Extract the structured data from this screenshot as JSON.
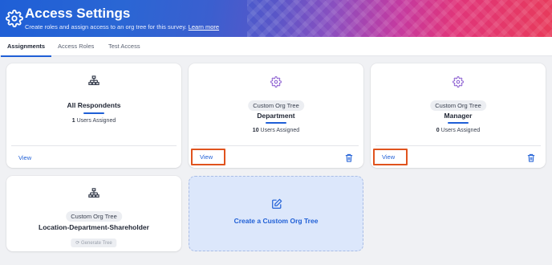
{
  "header": {
    "title": "Access Settings",
    "subtitle": "Create roles and assign access to an org tree for this survey.",
    "learn_more": "Learn more"
  },
  "tabs": [
    {
      "label": "Assignments",
      "active": true
    },
    {
      "label": "Access Roles",
      "active": false
    },
    {
      "label": "Test Access",
      "active": false
    }
  ],
  "cards": {
    "all_respondents": {
      "title": "All Respondents",
      "users_count": "1",
      "users_suffix": " Users Assigned",
      "view": "View"
    },
    "department": {
      "badge": "Custom Org Tree",
      "title": "Department",
      "users_count": "10",
      "users_suffix": " Users Assigned",
      "view": "View"
    },
    "manager": {
      "badge": "Custom Org Tree",
      "title": "Manager",
      "users_count": "0",
      "users_suffix": " Users Assigned",
      "view": "View"
    },
    "location": {
      "badge": "Custom Org Tree",
      "title": "Location-Department-Shareholder",
      "generate": "Generate Tree"
    },
    "create": {
      "title": "Create a Custom Org Tree"
    }
  },
  "colors": {
    "accent": "#1f5fd6",
    "highlight": "#e0531e",
    "icon_purple": "#8a5cd0"
  }
}
